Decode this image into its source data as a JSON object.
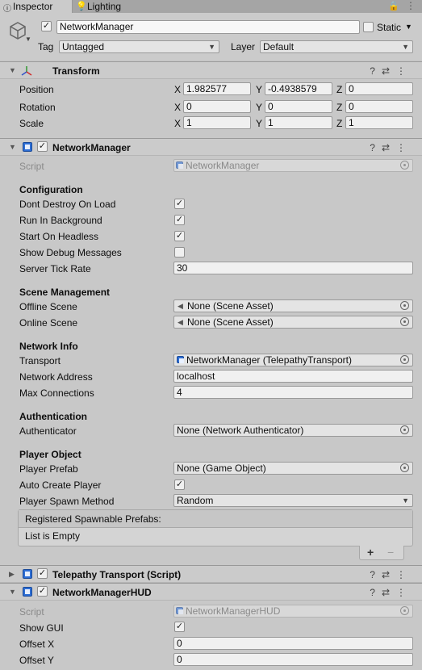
{
  "tabs": {
    "inspector": "Inspector",
    "lighting": "Lighting"
  },
  "object": {
    "name": "NetworkManager",
    "static_label": "Static",
    "tag_label": "Tag",
    "tag_value": "Untagged",
    "layer_label": "Layer",
    "layer_value": "Default"
  },
  "transform": {
    "title": "Transform",
    "position_label": "Position",
    "rotation_label": "Rotation",
    "scale_label": "Scale",
    "axis_x": "X",
    "axis_y": "Y",
    "axis_z": "Z",
    "position": {
      "x": "1.982577",
      "y": "-0.4938579",
      "z": "0"
    },
    "rotation": {
      "x": "0",
      "y": "0",
      "z": "0"
    },
    "scale": {
      "x": "1",
      "y": "1",
      "z": "1"
    }
  },
  "network_manager": {
    "title": "NetworkManager",
    "script_label": "Script",
    "script_value": "NetworkManager",
    "configuration_header": "Configuration",
    "dont_destroy_label": "Dont Destroy On Load",
    "run_in_background_label": "Run In Background",
    "start_on_headless_label": "Start On Headless",
    "show_debug_label": "Show Debug Messages",
    "server_tick_rate_label": "Server Tick Rate",
    "server_tick_rate_value": "30",
    "scene_management_header": "Scene Management",
    "offline_scene_label": "Offline Scene",
    "offline_scene_value": "None (Scene Asset)",
    "online_scene_label": "Online Scene",
    "online_scene_value": "None (Scene Asset)",
    "network_info_header": "Network Info",
    "transport_label": "Transport",
    "transport_value": "NetworkManager (TelepathyTransport)",
    "network_address_label": "Network Address",
    "network_address_value": "localhost",
    "max_connections_label": "Max Connections",
    "max_connections_value": "4",
    "authentication_header": "Authentication",
    "authenticator_label": "Authenticator",
    "authenticator_value": "None (Network Authenticator)",
    "player_object_header": "Player Object",
    "player_prefab_label": "Player Prefab",
    "player_prefab_value": "None (Game Object)",
    "auto_create_label": "Auto Create Player",
    "spawn_method_label": "Player Spawn Method",
    "spawn_method_value": "Random",
    "spawnable_header": "Registered Spawnable Prefabs:",
    "list_empty": "List is Empty",
    "plus": "+",
    "minus": "−",
    "checkmark": "✓"
  },
  "telepathy": {
    "title": "Telepathy Transport (Script)"
  },
  "hud": {
    "title": "NetworkManagerHUD",
    "script_label": "Script",
    "script_value": "NetworkManagerHUD",
    "show_gui_label": "Show GUI",
    "offset_x_label": "Offset X",
    "offset_x_value": "0",
    "offset_y_label": "Offset Y",
    "offset_y_value": "0"
  }
}
